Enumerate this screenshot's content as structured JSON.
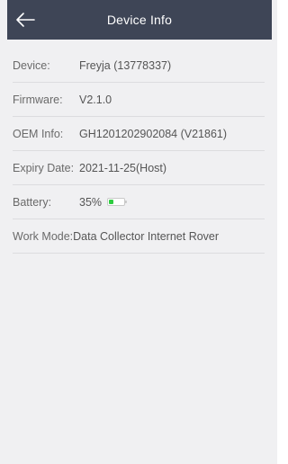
{
  "header": {
    "title": "Device Info",
    "back_icon": "arrow-left-icon"
  },
  "rows": [
    {
      "label": "Device:",
      "value": "Freyja (13778337)"
    },
    {
      "label": "Firmware:",
      "value": "V2.1.0"
    },
    {
      "label": "OEM Info:",
      "value": "GH1201202902084 (V21861)"
    },
    {
      "label": "Expiry Date:",
      "value": "2021-11-25(Host)"
    },
    {
      "label": "Battery:",
      "value": "35%",
      "battery_level": 0.35
    },
    {
      "label": "Work Mode:",
      "value": "Data Collector Internet Rover"
    }
  ],
  "colors": {
    "header_bg": "#3e4556",
    "page_bg": "#f0f0f2",
    "battery_fill": "#2ecc40"
  }
}
